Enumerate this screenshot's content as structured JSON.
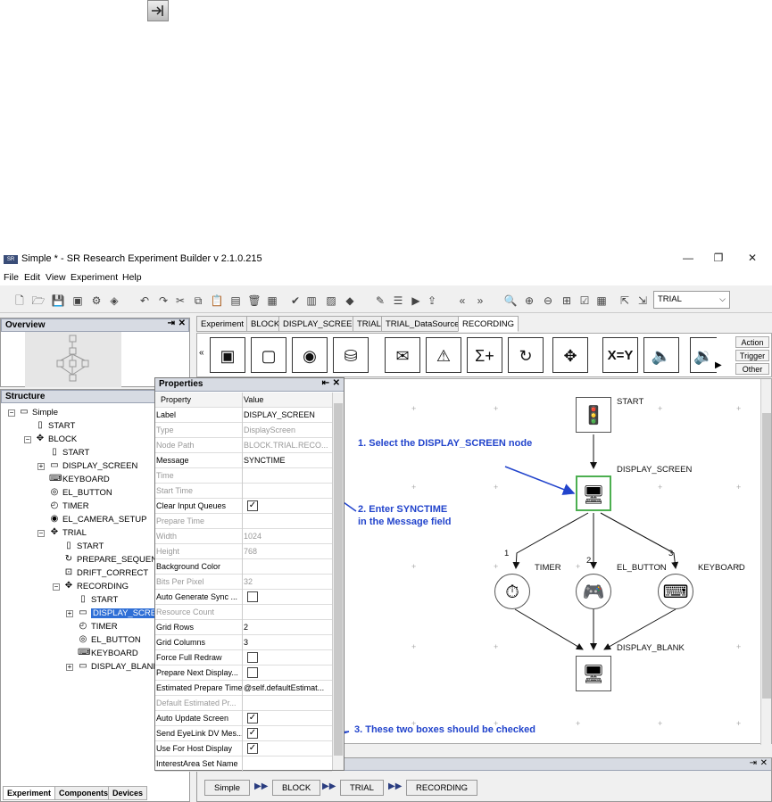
{
  "window": {
    "title": "Simple * - SR Research Experiment Builder v 2.1.0.215",
    "menu": [
      "File",
      "Edit",
      "View",
      "Experiment",
      "Help"
    ],
    "toolbar_select": "TRIAL"
  },
  "overview": {
    "title": "Overview"
  },
  "structure": {
    "title": "Structure",
    "items": [
      {
        "label": "Simple"
      },
      {
        "label": "START"
      },
      {
        "label": "BLOCK"
      },
      {
        "label": "START"
      },
      {
        "label": "DISPLAY_SCREEN"
      },
      {
        "label": "KEYBOARD"
      },
      {
        "label": "EL_BUTTON"
      },
      {
        "label": "TIMER"
      },
      {
        "label": "EL_CAMERA_SETUP"
      },
      {
        "label": "TRIAL"
      },
      {
        "label": "START"
      },
      {
        "label": "PREPARE_SEQUENCE"
      },
      {
        "label": "DRIFT_CORRECT"
      },
      {
        "label": "RECORDING"
      },
      {
        "label": "START"
      },
      {
        "label": "DISPLAY_SCREEN"
      },
      {
        "label": "TIMER"
      },
      {
        "label": "EL_BUTTON"
      },
      {
        "label": "KEYBOARD"
      },
      {
        "label": "DISPLAY_BLANK"
      }
    ],
    "tabs": [
      "Experiment",
      "Components",
      "Devices"
    ]
  },
  "main_tabs": [
    "Experiment",
    "BLOCK",
    "DISPLAY_SCREEN",
    "TRIAL",
    "TRIAL_DataSource",
    "RECORDING"
  ],
  "palette_side": [
    "Action",
    "Trigger",
    "Other"
  ],
  "canvas": {
    "nodes": {
      "start": "START",
      "display_screen": "DISPLAY_SCREEN",
      "timer": "TIMER",
      "el_button": "EL_BUTTON",
      "keyboard": "KEYBOARD",
      "display_blank": "DISPLAY_BLANK"
    },
    "edge_labels": [
      "1",
      "2",
      "3"
    ],
    "annotations": {
      "a1": "1. Select the DISPLAY_SCREEN node",
      "a2_line1": "2. Enter SYNCTIME",
      "a2_line2": "in the Message field",
      "a3": "3. These two boxes should be checked"
    },
    "accent_color": "#2244cc"
  },
  "breadcrumbs": [
    "Simple",
    "BLOCK",
    "TRIAL",
    "RECORDING"
  ],
  "properties": {
    "title": "Properties",
    "header": {
      "key": "Property",
      "value": "Value"
    },
    "rows": [
      {
        "key": "Label",
        "value": "DISPLAY_SCREEN"
      },
      {
        "key": "Type",
        "value": "DisplayScreen"
      },
      {
        "key": "Node Path",
        "value": "BLOCK.TRIAL.RECO..."
      },
      {
        "key": "Message",
        "value": "SYNCTIME"
      },
      {
        "key": "Time",
        "value": ""
      },
      {
        "key": "Start Time",
        "value": ""
      },
      {
        "key": "Clear Input Queues",
        "value": ""
      },
      {
        "key": "Prepare Time",
        "value": ""
      },
      {
        "key": "Width",
        "value": "1024"
      },
      {
        "key": "Height",
        "value": "768"
      },
      {
        "key": "Background Color",
        "value": ""
      },
      {
        "key": "Bits Per Pixel",
        "value": "32"
      },
      {
        "key": "Auto Generate Sync ...",
        "value": ""
      },
      {
        "key": "Resource Count",
        "value": ""
      },
      {
        "key": "Grid Rows",
        "value": "2"
      },
      {
        "key": "Grid Columns",
        "value": "3"
      },
      {
        "key": "Force Full Redraw",
        "value": ""
      },
      {
        "key": "Prepare Next Display...",
        "value": ""
      },
      {
        "key": "Estimated Prepare Time",
        "value": "@self.defaultEstimat..."
      },
      {
        "key": "Default Estimated Pr...",
        "value": ""
      },
      {
        "key": "Auto Update Screen",
        "value": ""
      },
      {
        "key": "Send EyeLink DV Mes...",
        "value": ""
      },
      {
        "key": "Use For Host Display",
        "value": ""
      },
      {
        "key": "InterestArea Set Name",
        "value": ""
      }
    ]
  }
}
